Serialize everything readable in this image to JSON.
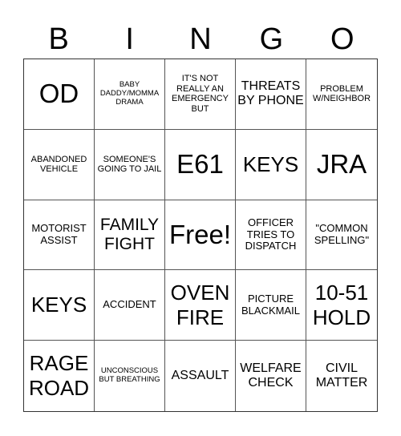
{
  "header": [
    "B",
    "I",
    "N",
    "G",
    "O"
  ],
  "cells": [
    {
      "text": "OD",
      "size": "huge"
    },
    {
      "text": "BABY DADDY/MOMMA DRAMA",
      "size": "xs"
    },
    {
      "text": "IT'S NOT REALLY AN EMERGENCY BUT",
      "size": "sm"
    },
    {
      "text": "THREATS BY PHONE",
      "size": "lg"
    },
    {
      "text": "PROBLEM W/NEIGHBOR",
      "size": "sm"
    },
    {
      "text": "ABANDONED VEHICLE",
      "size": "sm"
    },
    {
      "text": "SOMEONE'S GOING TO JAIL",
      "size": "sm"
    },
    {
      "text": "E61",
      "size": "huge"
    },
    {
      "text": "KEYS",
      "size": "xxl"
    },
    {
      "text": "JRA",
      "size": "huge"
    },
    {
      "text": "MOTORIST ASSIST",
      "size": "md"
    },
    {
      "text": "FAMILY FIGHT",
      "size": "xl"
    },
    {
      "text": "Free!",
      "size": "huge"
    },
    {
      "text": "OFFICER TRIES TO DISPATCH",
      "size": "md"
    },
    {
      "text": "\"COMMON SPELLING\"",
      "size": "md"
    },
    {
      "text": "KEYS",
      "size": "xxl"
    },
    {
      "text": "ACCIDENT",
      "size": "md"
    },
    {
      "text": "OVEN FIRE",
      "size": "xxl"
    },
    {
      "text": "PICTURE BLACKMAIL",
      "size": "md"
    },
    {
      "text": "10-51 HOLD",
      "size": "xxl"
    },
    {
      "text": "RAGE ROAD",
      "size": "xxl"
    },
    {
      "text": "UNCONSCIOUS BUT BREATHING",
      "size": "xs"
    },
    {
      "text": "ASSAULT",
      "size": "lg"
    },
    {
      "text": "WELFARE CHECK",
      "size": "lg"
    },
    {
      "text": "CIVIL MATTER",
      "size": "lg"
    }
  ]
}
